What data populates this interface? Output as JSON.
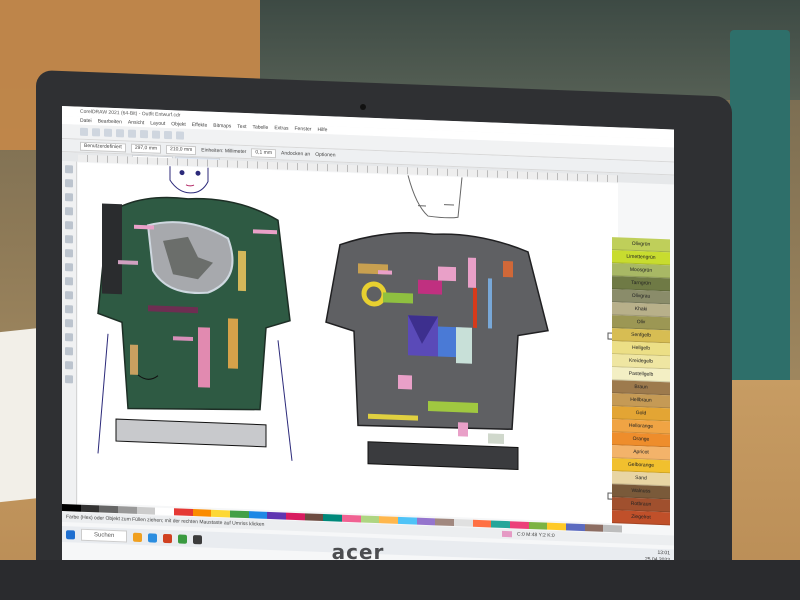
{
  "app": {
    "title_bar": "CorelDRAW 2021 (64-Bit) - Outfit Entwurf.cdr",
    "menu": [
      "Datei",
      "Bearbeiten",
      "Ansicht",
      "Layout",
      "Objekt",
      "Effekte",
      "Bitmaps",
      "Text",
      "Tabelle",
      "Extras",
      "Fenster",
      "Hilfe"
    ],
    "property_bar": {
      "preset": "Benutzerdefiniert",
      "width": "297,0 mm",
      "height": "210,0 mm",
      "units": "Einheiten: Millimeter",
      "nudge": "0,1 mm",
      "snap": "Andocken an",
      "options": "Optionen"
    },
    "doc_tabs": [
      {
        "label": "Willkommen",
        "active": false
      },
      {
        "label": "Outfit Entwurf",
        "active": true
      }
    ],
    "status_bar": "Farbe (Hex) oder Objekt zum Füllen ziehen; mit der rechten Maustaste auf Umriss klicken",
    "color_readout": "C:0 M:48 Y:2 K:0",
    "taskbar": {
      "search_placeholder": "Suchen",
      "time": "13:01",
      "date": "25.04.2022"
    }
  },
  "palette": {
    "colors": [
      {
        "name": "Olivgrün",
        "hex": "#bfcf5a"
      },
      {
        "name": "Limettengrün",
        "hex": "#c8dc2f"
      },
      {
        "name": "Moosgrün",
        "hex": "#a8b865"
      },
      {
        "name": "Tarngrün",
        "hex": "#6f7a45"
      },
      {
        "name": "Olivgrau",
        "hex": "#8a8c6a"
      },
      {
        "name": "Khaki",
        "hex": "#b8b08a"
      },
      {
        "name": "Oliv",
        "hex": "#9c9754"
      },
      {
        "name": "Senfgelb",
        "hex": "#d7bd53"
      },
      {
        "name": "Hellgelb",
        "hex": "#ecdf86"
      },
      {
        "name": "Kreidegelb",
        "hex": "#efe6a2"
      },
      {
        "name": "Pastellgelb",
        "hex": "#f3efc4"
      },
      {
        "name": "Braun",
        "hex": "#9d7a4d"
      },
      {
        "name": "Hellbraun",
        "hex": "#c59a55"
      },
      {
        "name": "Gold",
        "hex": "#e3a534"
      },
      {
        "name": "Hellorange",
        "hex": "#f0a444"
      },
      {
        "name": "Orange",
        "hex": "#ee8d2c"
      },
      {
        "name": "Apricot",
        "hex": "#f3b36a"
      },
      {
        "name": "Gelborange",
        "hex": "#f1c02e"
      },
      {
        "name": "Sand",
        "hex": "#e8d5a4"
      },
      {
        "name": "Walnuss",
        "hex": "#7a5a3a"
      },
      {
        "name": "Rotbraun",
        "hex": "#a0502e"
      },
      {
        "name": "Ziegelrot",
        "hex": "#c0502a"
      }
    ]
  },
  "color_row": [
    "#000000",
    "#333333",
    "#666666",
    "#999999",
    "#cccccc",
    "#ffffff",
    "#e53935",
    "#fb8c00",
    "#fdd835",
    "#43a047",
    "#1e88e5",
    "#5e35b1",
    "#d81b60",
    "#6d4c41",
    "#00897b",
    "#f06292",
    "#aed581",
    "#ffb74d",
    "#4fc3f7",
    "#9575cd",
    "#a1887f",
    "#e0e0e0",
    "#ff7043",
    "#26a69a",
    "#ec407a",
    "#7cb342",
    "#ffca28",
    "#5c6bc0",
    "#8d6e63",
    "#bdbdbd"
  ],
  "laptop": {
    "brand": "acer"
  }
}
